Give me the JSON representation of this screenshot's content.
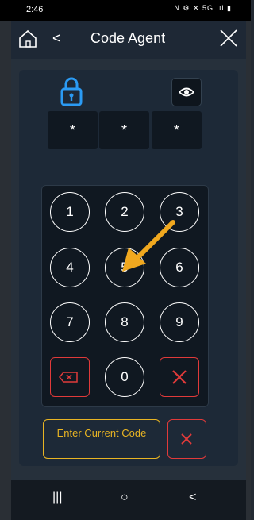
{
  "status_bar": {
    "time": "2:46",
    "icons": "N ⚙ ✕ 5G .ıl ▮"
  },
  "header": {
    "title": "Code Agent",
    "back_glyph": "<"
  },
  "code": {
    "digits": [
      "*",
      "*",
      "*"
    ]
  },
  "keypad": {
    "keys": [
      "1",
      "2",
      "3",
      "4",
      "5",
      "6",
      "7",
      "8",
      "9",
      "0"
    ]
  },
  "actions": {
    "enter_label": "Enter Current Code"
  },
  "nav": {
    "recents": "|||",
    "home": "○",
    "back": "<"
  },
  "colors": {
    "accent_blue": "#2b9bf4",
    "accent_yellow": "#e8b423",
    "accent_red": "#e03a3a",
    "arrow": "#f0a81f",
    "background": "#232a33"
  }
}
